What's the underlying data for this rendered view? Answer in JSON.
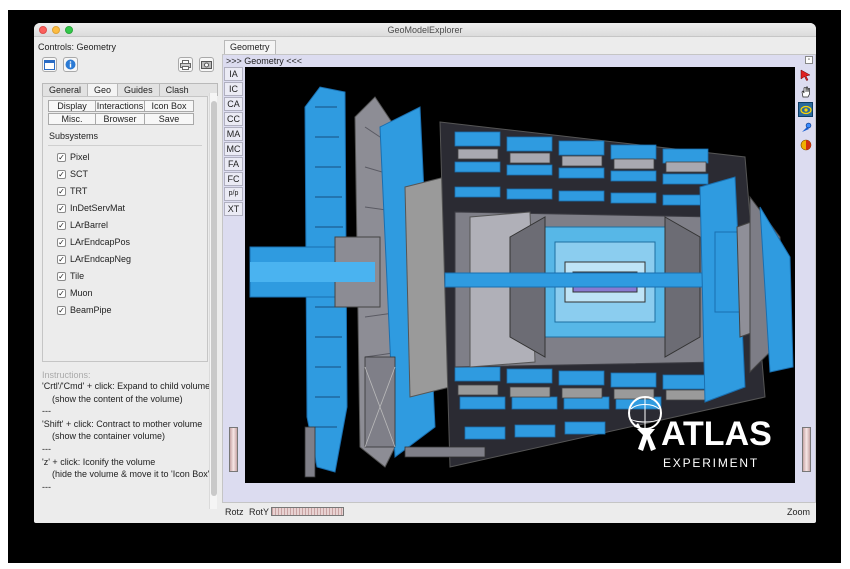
{
  "window": {
    "title": "GeoModelExplorer"
  },
  "controls": {
    "title": "Controls: Geometry",
    "toolbar": [
      {
        "icon": "window-icon"
      },
      {
        "icon": "info-icon"
      },
      {
        "icon": "print-icon"
      },
      {
        "icon": "snapshot-icon"
      }
    ]
  },
  "tabs": [
    "General",
    "Geo",
    "Guides",
    "Clash Points"
  ],
  "active_tab": "Geo",
  "geo_buttons": {
    "display": "Display",
    "interactions": "Interactions",
    "icon_box": "Icon Box",
    "misc": "Misc.",
    "browser": "Browser",
    "save": "Save"
  },
  "subsystems_label": "Subsystems",
  "subsystems": [
    {
      "label": "Pixel",
      "checked": true
    },
    {
      "label": "SCT",
      "checked": true
    },
    {
      "label": "TRT",
      "checked": true
    },
    {
      "label": "InDetServMat",
      "checked": true
    },
    {
      "label": "LArBarrel",
      "checked": true
    },
    {
      "label": "LArEndcapPos",
      "checked": true
    },
    {
      "label": "LArEndcapNeg",
      "checked": true
    },
    {
      "label": "Tile",
      "checked": true
    },
    {
      "label": "Muon",
      "checked": true
    },
    {
      "label": "BeamPipe",
      "checked": true
    }
  ],
  "instructions": {
    "title": "Instructions:",
    "lines": [
      {
        "text": "'Crtl'/'Cmd' + click: Expand to child volumes",
        "indent": false
      },
      {
        "text": "(show the content of the volume)",
        "indent": true
      },
      {
        "text": "---",
        "indent": false
      },
      {
        "text": "'Shift' + click: Contract to mother volume",
        "indent": false
      },
      {
        "text": "(show the container volume)",
        "indent": true
      },
      {
        "text": "---",
        "indent": false
      },
      {
        "text": "'z' + click: Iconify the volume",
        "indent": false
      },
      {
        "text": "(hide the volume & move it to 'Icon Box')",
        "indent": true
      },
      {
        "text": "---",
        "indent": false
      }
    ]
  },
  "viewer": {
    "tab": "Geometry",
    "header": ">>> Geometry <<<",
    "view_buttons": [
      "IA",
      "IC",
      "CA",
      "CC",
      "MA",
      "MC",
      "FA",
      "FC",
      "p/p",
      "XT"
    ],
    "right_tools": [
      {
        "icon": "select-arrow-icon"
      },
      {
        "icon": "pan-hand-icon"
      },
      {
        "icon": "home-icon"
      },
      {
        "icon": "seek-icon"
      },
      {
        "icon": "perspective-icon"
      }
    ],
    "rotz_label": "Rotz",
    "roty_label": "RotY",
    "zoom_label": "Zoom",
    "logo_text": "ATLAS",
    "logo_subtext": "EXPERIMENT"
  },
  "colors": {
    "detector_blue": "#2f9be0",
    "detector_grey": "#9a9a9a",
    "canvas_bg": "#000000",
    "viewer_frame": "#dcdcf0"
  }
}
